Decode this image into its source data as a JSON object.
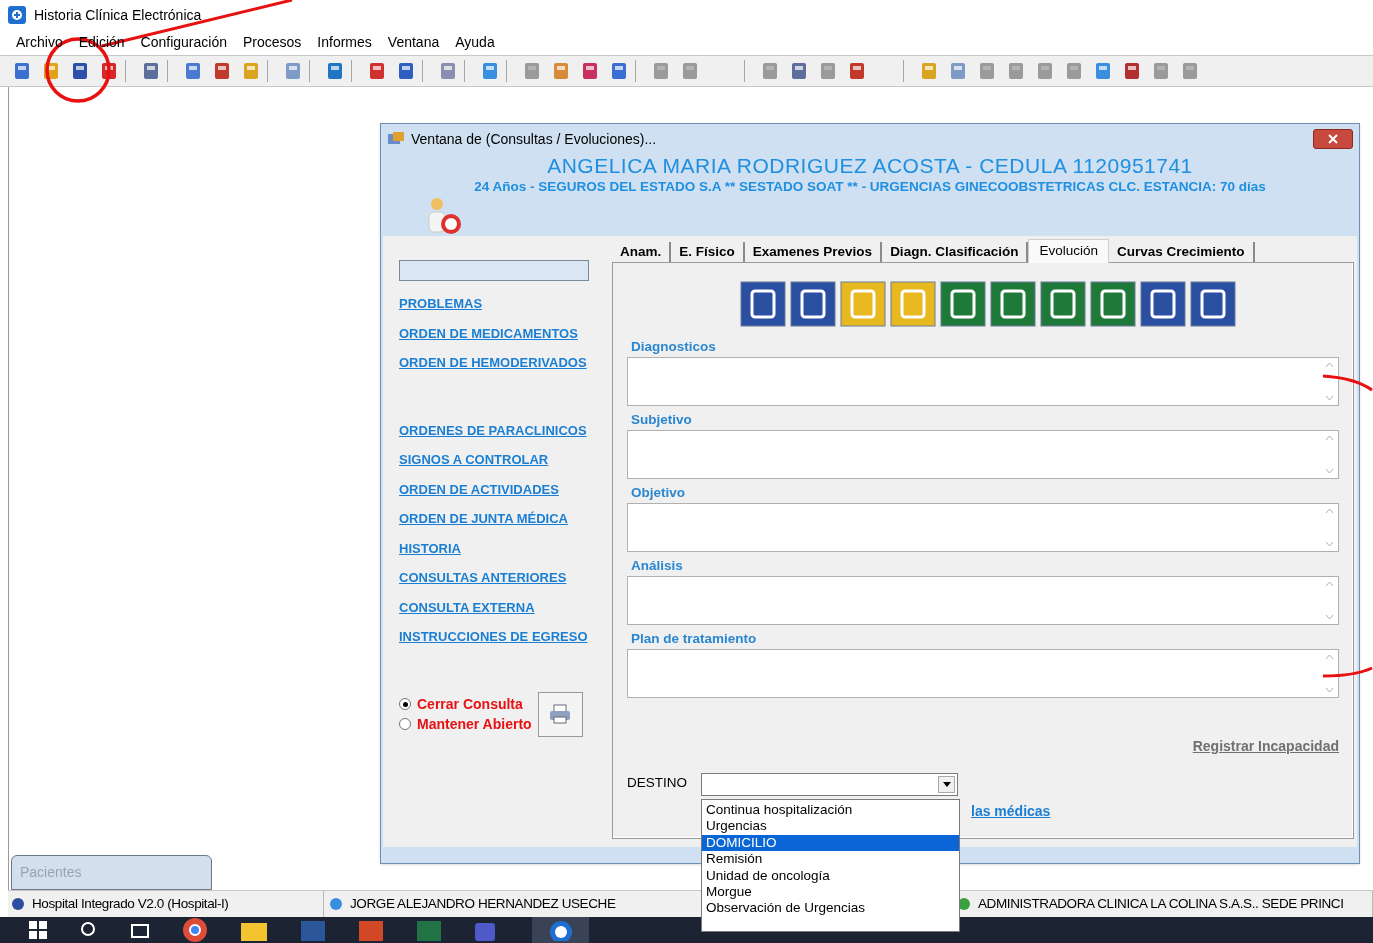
{
  "app_title": "Historia Clínica Electrónica",
  "menu": [
    "Archivo",
    "Edición",
    "Configuración",
    "Procesos",
    "Informes",
    "Ventana",
    "Ayuda"
  ],
  "toolbar": [
    [
      {
        "disabled": false
      },
      {
        "disabled": false
      },
      {
        "disabled": false
      },
      {
        "disabled": false
      }
    ],
    [
      {
        "disabled": false
      }
    ],
    [
      {
        "disabled": false
      },
      {
        "disabled": false
      },
      {
        "disabled": false
      }
    ],
    [
      {
        "disabled": false
      }
    ],
    [
      {
        "disabled": false
      }
    ],
    [
      {
        "disabled": false
      },
      {
        "disabled": false
      }
    ],
    [
      {
        "disabled": false
      }
    ],
    [
      {
        "disabled": false
      }
    ],
    [
      {
        "disabled": true
      },
      {
        "disabled": false
      },
      {
        "disabled": false
      },
      {
        "disabled": false
      }
    ],
    [
      {
        "disabled": true
      },
      {
        "disabled": true
      }
    ],
    [
      {
        "disabled": true
      },
      {
        "disabled": false
      },
      {
        "disabled": true
      },
      {
        "disabled": false
      }
    ],
    [
      {
        "disabled": false
      },
      {
        "disabled": false
      },
      {
        "disabled": true
      },
      {
        "disabled": true
      },
      {
        "disabled": true
      },
      {
        "disabled": true
      },
      {
        "disabled": false
      },
      {
        "disabled": false
      },
      {
        "disabled": true
      },
      {
        "disabled": true
      }
    ]
  ],
  "window": {
    "title": "Ventana de (Consultas / Evoluciones)...",
    "patient": "ANGELICA MARIA RODRIGUEZ ACOSTA  -  CEDULA 1120951741",
    "details": "24 Años  -  SEGUROS DEL ESTADO S.A ** SESTADO SOAT ** - URGENCIAS GINECOOBSTETRICAS CLC.  ESTANCIA: 70 días",
    "link_groups": [
      [
        "PROBLEMAS",
        "ORDEN DE MEDICAMENTOS",
        "ORDEN DE HEMODERIVADOS"
      ],
      [
        "ORDENES DE PARACLINICOS",
        "SIGNOS A CONTROLAR",
        "ORDEN DE ACTIVIDADES",
        "ORDEN DE JUNTA MÉDICA",
        "HISTORIA",
        "CONSULTAS ANTERIORES",
        "CONSULTA EXTERNA",
        "INSTRUCCIONES DE EGRESO"
      ]
    ],
    "radios": [
      {
        "label": "Cerrar Consulta",
        "selected": true
      },
      {
        "label": "Mantener Abierto",
        "selected": false
      }
    ],
    "tabs": [
      {
        "label": "Anam.",
        "selected": false
      },
      {
        "label": "E. Físico",
        "selected": false
      },
      {
        "label": "Examenes Previos",
        "selected": false
      },
      {
        "label": "Diagn. Clasificación",
        "selected": false
      },
      {
        "label": "Evolución",
        "selected": true
      },
      {
        "label": "Curvas Crecimiento",
        "selected": false
      }
    ],
    "fields": [
      "Diagnosticos",
      "Subjetivo",
      "Objetivo",
      "Análisis",
      "Plan de tratamiento"
    ],
    "incapacity_link": "Registrar Incapacidad",
    "destino": {
      "label": "DESTINO",
      "options": [
        {
          "label": "Continua hospitalización",
          "selected": false
        },
        {
          "label": "Urgencias",
          "selected": false
        },
        {
          "label": "DOMICILIO",
          "selected": true
        },
        {
          "label": "Remisión",
          "selected": false
        },
        {
          "label": "Unidad de oncología",
          "selected": false
        },
        {
          "label": "Morgue",
          "selected": false
        },
        {
          "label": "Observación de Urgencias",
          "selected": false
        }
      ]
    },
    "partial_link": "las médicas"
  },
  "minimized_window": "Pacientes",
  "status_bar": [
    "Hospital Integrado V2.0 (Hospital-I)",
    "JORGE ALEJANDRO HERNANDEZ USECHE",
    "ADMINISTRADORA CLINICA LA COLINA S.A.S..  SEDE PRINCI"
  ]
}
